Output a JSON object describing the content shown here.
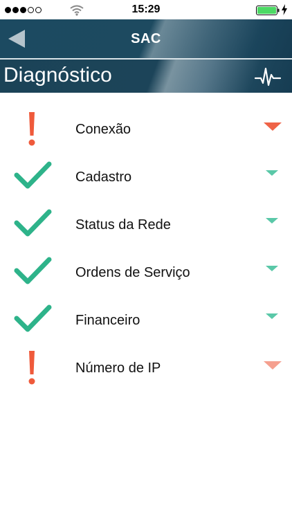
{
  "status_bar": {
    "time": "15:29",
    "signal_dots_filled": 3,
    "signal_dots_total": 5,
    "battery_level": 1.0
  },
  "nav": {
    "title": "SAC",
    "back_icon": "back-arrow-icon"
  },
  "section": {
    "title": "Diagnóstico",
    "icon": "pulse-icon"
  },
  "colors": {
    "ok": "#2eb38a",
    "ok_chevron": "#5ac8a8",
    "error": "#ef5a3b",
    "error_chevron": "#ef6347",
    "warning_chevron": "#f5a08f"
  },
  "items": [
    {
      "label": "Conexão",
      "status": "error",
      "chevron": "error"
    },
    {
      "label": "Cadastro",
      "status": "ok",
      "chevron": "ok"
    },
    {
      "label": "Status da Rede",
      "status": "ok",
      "chevron": "ok"
    },
    {
      "label": "Ordens de Serviço",
      "status": "ok",
      "chevron": "ok"
    },
    {
      "label": "Financeiro",
      "status": "ok",
      "chevron": "ok"
    },
    {
      "label": "Número de IP",
      "status": "error",
      "chevron": "warning"
    }
  ]
}
